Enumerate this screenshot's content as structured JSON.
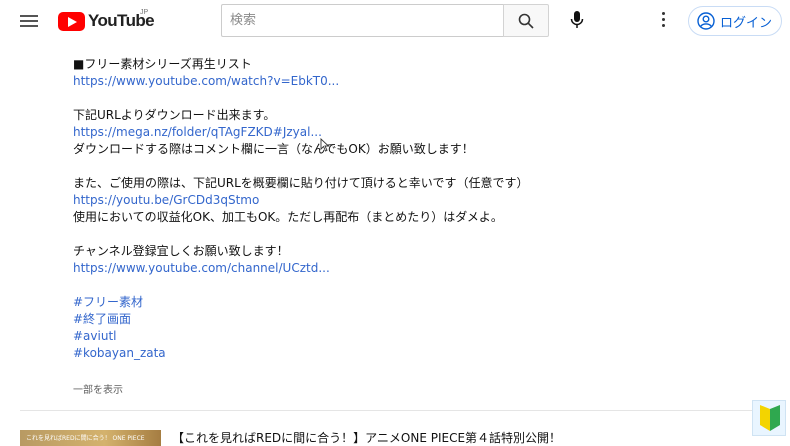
{
  "header": {
    "logo_text": "YouTube",
    "logo_region": "JP",
    "search_placeholder": "検索",
    "signin_label": "ログイン"
  },
  "description": {
    "lines": [
      "■フリー素材シリーズ再生リスト",
      "https://www.youtube.com/watch?v=EbkT0...",
      "",
      "下記URLよりダウンロード出来ます。",
      "https://mega.nz/folder/qTAgFZKD#Jzyal...",
      "ダウンロードする際はコメント欄に一言（なんでもOK）お願い致します！",
      "",
      "また、ご使用の際は、下記URLを概要欄に貼り付けて頂けると幸いです（任意です）",
      "https://youtu.be/GrCDd3qStmo",
      "使用においての収益化OK、加工もOK。ただし再配布（まとめたり）はダメよ。",
      "",
      "チャンネル登録宜しくお願い致します！",
      "https://www.youtube.com/channel/UCztd...",
      "",
      "#フリー素材",
      "#終了画面",
      "#aviutl",
      "#kobayan_zata"
    ],
    "show_less": "一部を表示"
  },
  "next_video": {
    "thumb_text": "これを見ればREDに間に合う！ ONE PIECE",
    "title": "【これを見ればREDに間に合う！】アニメONE PIECE第４話特別公開！"
  },
  "colors": {
    "brand": "#ff0000",
    "link": "#3366cc",
    "signin_text": "#065fd4"
  }
}
